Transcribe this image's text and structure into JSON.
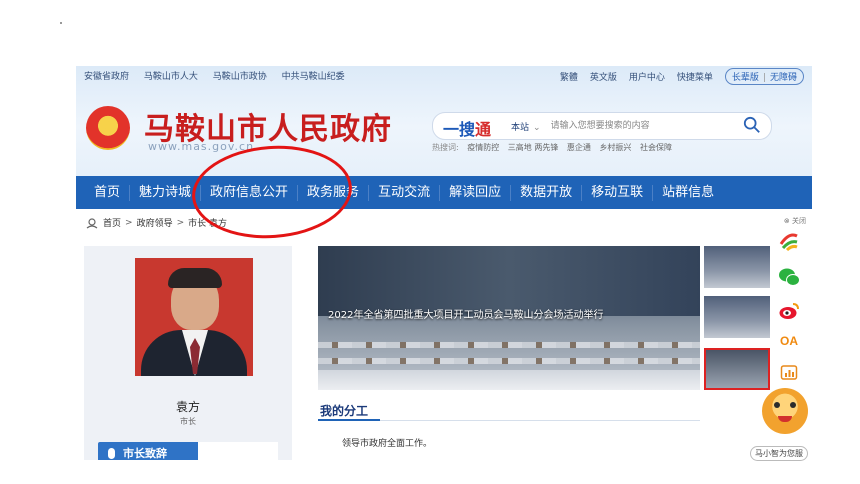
{
  "top_links": [
    "安徽省政府",
    "马鞍山市人大",
    "马鞍山市政协",
    "中共马鞍山纪委"
  ],
  "top_right": {
    "items": [
      "繁體",
      "英文版",
      "用户中心",
      "快捷菜单"
    ],
    "pill_left": "长辈版",
    "pill_sep": "|",
    "pill_right": "无障碍"
  },
  "site": {
    "title": "马鞍山市人民政府",
    "domain": "www.mas.gov.cn"
  },
  "search": {
    "brand_main": "一搜",
    "brand_tail": "通",
    "scope": "本站",
    "scope_chevron": "chevron-down-icon",
    "placeholder": "请输入您想要搜索的内容",
    "hot_label": "热搜词:",
    "hot_words": [
      "疫情防控",
      "三高地 两先锋",
      "惠企通",
      "乡村振兴",
      "社会保障"
    ]
  },
  "nav": [
    "首页",
    "魅力诗城",
    "政府信息公开",
    "政务服务",
    "互动交流",
    "解读回应",
    "数据开放",
    "移动互联",
    "站群信息"
  ],
  "breadcrumb": {
    "items": [
      "首页",
      "政府领导",
      "市长 袁方"
    ],
    "sep": ">"
  },
  "close_label": "⊗ 关闭",
  "leader": {
    "name": "袁方",
    "title": "市长",
    "speech_button": "市长致辞"
  },
  "slideshow": {
    "caption": "2022年全省第四批重大项目开工动员会马鞍山分会场活动举行"
  },
  "duty": {
    "heading": "我的分工",
    "text": "领导市政府全面工作。"
  },
  "sidebar_icons": [
    "app-icon",
    "wechat-icon",
    "weibo-icon",
    "oa-icon",
    "data-icon"
  ],
  "oa_label": "OA",
  "mascot_tag": "马小智为您服",
  "colors": {
    "nav_blue": "#1f63b7",
    "title_red": "#c81e1e",
    "annotation_red": "#e31414"
  }
}
